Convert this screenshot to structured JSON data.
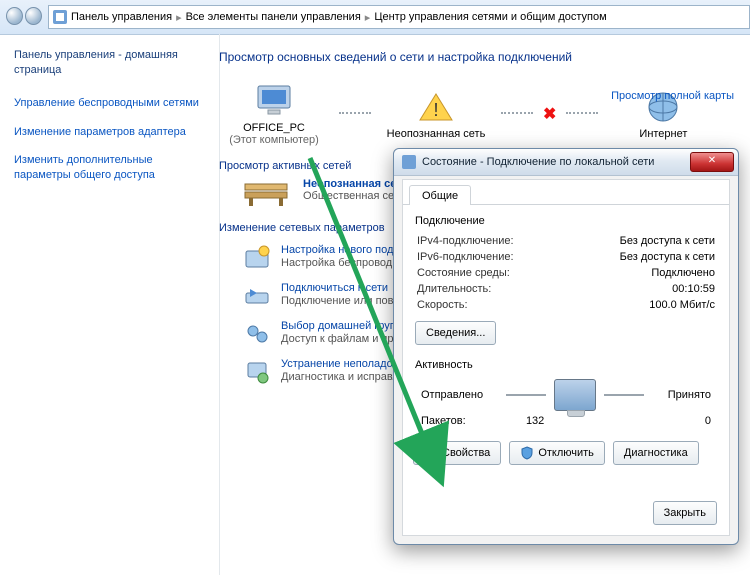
{
  "breadcrumb": {
    "a": "Панель управления",
    "b": "Все элементы панели управления",
    "c": "Центр управления сетями и общим доступом"
  },
  "left": {
    "home": "Панель управления - домашняя страница",
    "l1": "Управление беспроводными сетями",
    "l2": "Изменение параметров адаптера",
    "l3": "Изменить дополнительные параметры общего доступа"
  },
  "main": {
    "title": "Просмотр основных сведений о сети и настройка подключений",
    "full_map": "Просмотр полной карты",
    "node1": "OFFICE_PC",
    "node1_sub": "(Этот компьютер)",
    "node2": "Неопознанная сеть",
    "node3": "Интернет",
    "active_nets": "Просмотр активных сетей",
    "bench_title": "Неопознанная сеть",
    "bench_sub": "Общественная сеть",
    "net_params": "Изменение сетевых параметров",
    "p1_t": "Настройка нового подключения",
    "p1_d": "Настройка беспроводного, широкополосного или же настройка маршрутизатора",
    "p2_t": "Подключиться к сети",
    "p2_d": "Подключение или повторное сетевому соединению или подк",
    "p3_t": "Выбор домашней группы и пар",
    "p3_d": "Доступ к файлам и принтерам, изменение параметров общего",
    "p4_t": "Устранение неполадок",
    "p4_d": "Диагностика и исправление сет"
  },
  "dlg": {
    "title": "Состояние - Подключение по локальной сети",
    "tab": "Общие",
    "conn": "Подключение",
    "k_ipv4": "IPv4-подключение:",
    "v_ipv4": "Без доступа к сети",
    "k_ipv6": "IPv6-подключение:",
    "v_ipv6": "Без доступа к сети",
    "k_state": "Состояние среды:",
    "v_state": "Подключено",
    "k_dur": "Длительность:",
    "v_dur": "00:10:59",
    "k_speed": "Скорость:",
    "v_speed": "100.0 Мбит/с",
    "details": "Сведения...",
    "activity": "Активность",
    "sent": "Отправлено",
    "recv": "Принято",
    "packets_lbl": "Пакетов:",
    "sent_n": "132",
    "recv_n": "0",
    "btn_props": "Свойства",
    "btn_disable": "Отключить",
    "btn_diag": "Диагностика",
    "btn_close": "Закрыть"
  },
  "colors": {
    "accent": "#23a559"
  }
}
